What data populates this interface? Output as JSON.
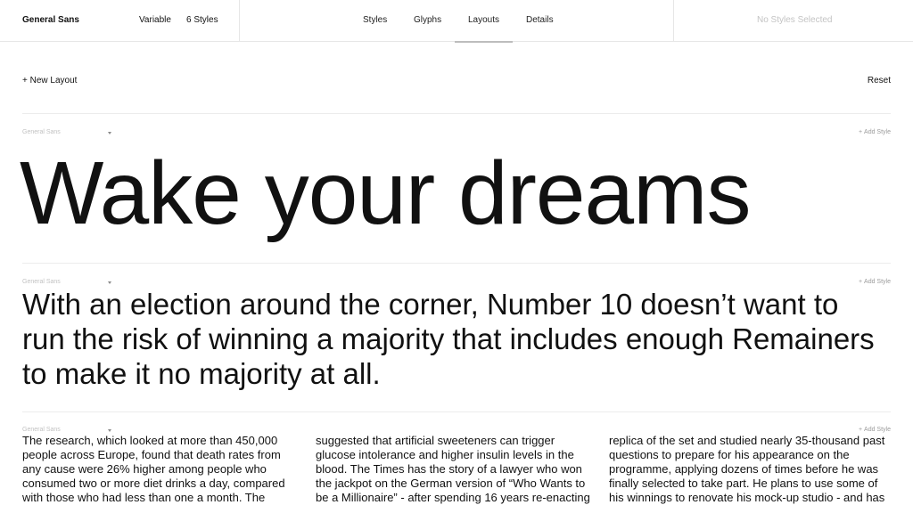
{
  "header": {
    "font_name": "General Sans",
    "variable_label": "Variable",
    "styles_count": "6 Styles",
    "tabs": [
      {
        "label": "Styles"
      },
      {
        "label": "Glyphs"
      },
      {
        "label": "Layouts",
        "active": true
      },
      {
        "label": "Details"
      }
    ],
    "selection_status": "No Styles Selected"
  },
  "actions": {
    "new_layout": "+ New Layout",
    "reset": "Reset"
  },
  "sections": [
    {
      "font_label": "General Sans",
      "add_style": "Add Style",
      "text": "Wake your dreams"
    },
    {
      "font_label": "General Sans",
      "add_style": "Add Style",
      "text": "With an election around the corner, Number 10 doesn’t want to run the risk of winning a majority that includes enough Remainers to make it no majority at all."
    },
    {
      "font_label": "General Sans",
      "add_style": "Add Style",
      "columns": [
        "The research, which looked at more than 450,000 people across Europe, found that death rates from any cause were 26% higher among people who consumed two or more diet drinks a day, compared with those who had less than one a month. The",
        "suggested that artificial sweeteners can trigger glucose intolerance and higher insulin levels in the blood. The Times has the story of a lawyer who won the jackpot on the German version of “Who Wants to be a Millionaire” - after spending 16 years re-enacting",
        "replica of the set and studied nearly 35-thousand past questions to prepare for his appearance on the programme, applying dozens of times before he was finally selected to take part. He plans to use some of his winnings to renovate his mock-up studio - and has"
      ]
    }
  ],
  "colors": {
    "text": "#111111",
    "muted": "#c4c4c4",
    "divider": "#e6e6e6",
    "active_tab_underline": "#bdbdbd"
  },
  "icons": {
    "font_select_caret": "caret-down-icon",
    "add_style_plus": "plus-icon"
  }
}
